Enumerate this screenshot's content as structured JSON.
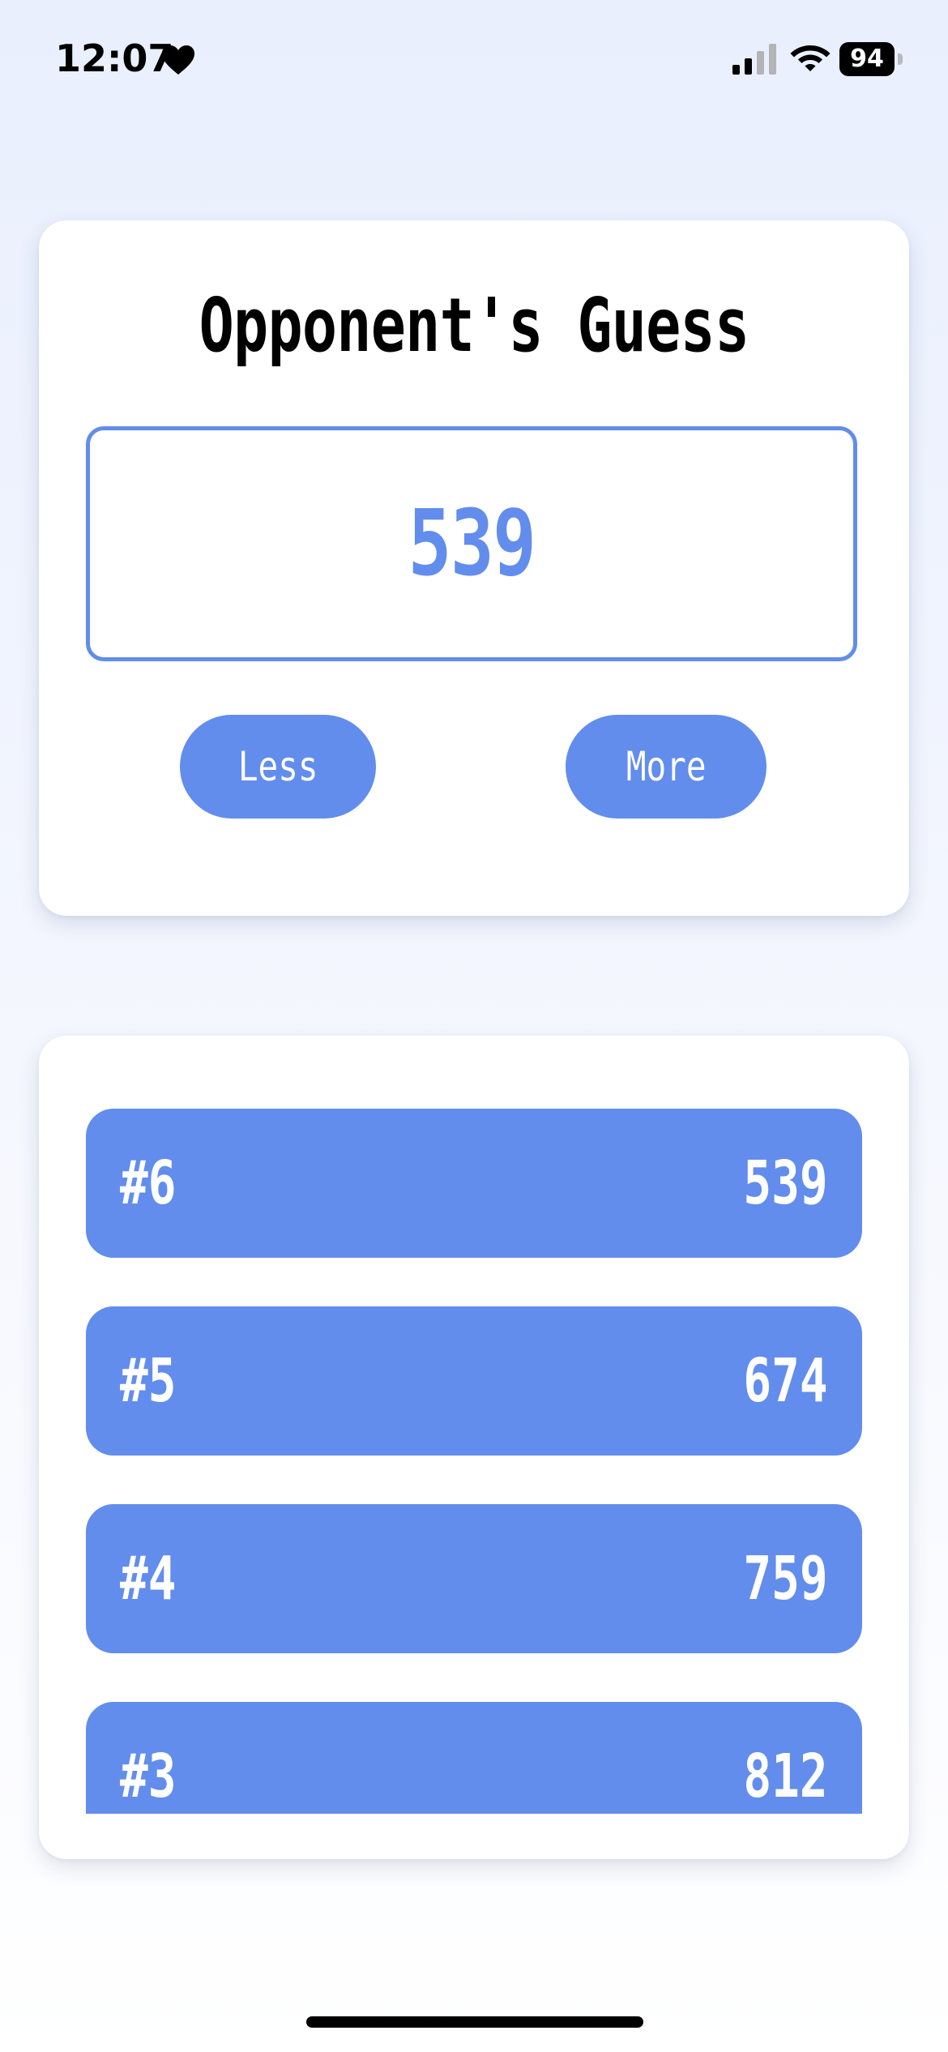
{
  "status_bar": {
    "time": "12:07",
    "battery_level": "94",
    "icons": [
      "heart-icon",
      "cellular-signal-icon",
      "wifi-icon",
      "battery-icon"
    ]
  },
  "guess_card": {
    "title": "Opponent's Guess",
    "guess_value": "539",
    "less_label": "Less",
    "more_label": "More"
  },
  "history": {
    "rows": [
      {
        "index": "#6",
        "value": "539"
      },
      {
        "index": "#5",
        "value": "674"
      },
      {
        "index": "#4",
        "value": "759"
      },
      {
        "index": "#3",
        "value": "812"
      }
    ]
  },
  "colors": {
    "accent": "#628dec",
    "background": "#e9effd",
    "card": "#ffffff",
    "text": "#000000"
  }
}
